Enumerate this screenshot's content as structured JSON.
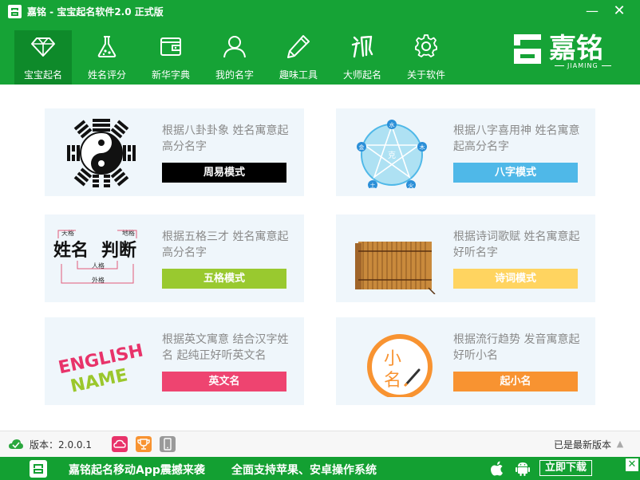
{
  "window": {
    "title": "嘉铭 - 宝宝起名软件2.0 正式版",
    "minimize_glyph": "—",
    "close_glyph": "✕"
  },
  "nav": {
    "items": [
      {
        "label": "宝宝起名",
        "icon": "diamond-icon",
        "active": true
      },
      {
        "label": "姓名评分",
        "icon": "flask-icon",
        "active": false
      },
      {
        "label": "新华字典",
        "icon": "wallet-book-icon",
        "active": false
      },
      {
        "label": "我的名字",
        "icon": "user-icon",
        "active": false
      },
      {
        "label": "趣味工具",
        "icon": "pencil-icon",
        "active": false
      },
      {
        "label": "大师起名",
        "icon": "master-calligraphy-icon",
        "active": false
      },
      {
        "label": "关于软件",
        "icon": "gear-icon",
        "active": false
      }
    ]
  },
  "brand": {
    "name": "嘉铭",
    "sub": "JIAMING"
  },
  "cards": [
    {
      "desc": "根据八卦卦象 姓名寓意起高分名字",
      "button": "周易模式",
      "color": "#000000",
      "image": "bagua-yinyang-icon"
    },
    {
      "desc": "根据八字喜用神 姓名寓意起高分名字",
      "button": "八字模式",
      "color": "#4fb8e8",
      "image": "five-elements-star-icon",
      "elements": [
        "水",
        "木",
        "火",
        "土",
        "金"
      ],
      "center": "克"
    },
    {
      "desc": "根据五格三才 姓名寓意起高分名字",
      "button": "五格模式",
      "color": "#99c92f",
      "image": "wuge-calligraphy-icon",
      "calligraphy": {
        "main1": "姓名",
        "main2": "判断",
        "tian": "天格",
        "di": "地格",
        "ren": "人格",
        "wai": "外格"
      }
    },
    {
      "desc": "根据诗词歌赋 姓名寓意起好听名字",
      "button": "诗词模式",
      "color": "#ffd460",
      "image": "bamboo-scroll-icon"
    },
    {
      "desc": "根据英文寓意 结合汉字姓名 起纯正好听英文名",
      "button": "英文名",
      "color": "#ee4470",
      "image": "english-name-icon",
      "art": {
        "word1": "ENGLISH",
        "word2": "NAME"
      }
    },
    {
      "desc": "根据流行趋势 发音寓意起好听小名",
      "button": "起小名",
      "color": "#f89331",
      "image": "nickname-circle-icon",
      "art": {
        "text1": "小",
        "text2": "名"
      }
    }
  ],
  "status": {
    "version": "版本：2.0.0.1",
    "latest": "已是最新版本"
  },
  "promo": {
    "text1": "嘉铭起名移动App震撼来袭",
    "text2": "全面支持苹果、安卓操作系统",
    "download": "立即下载",
    "close_glyph": "✕"
  }
}
